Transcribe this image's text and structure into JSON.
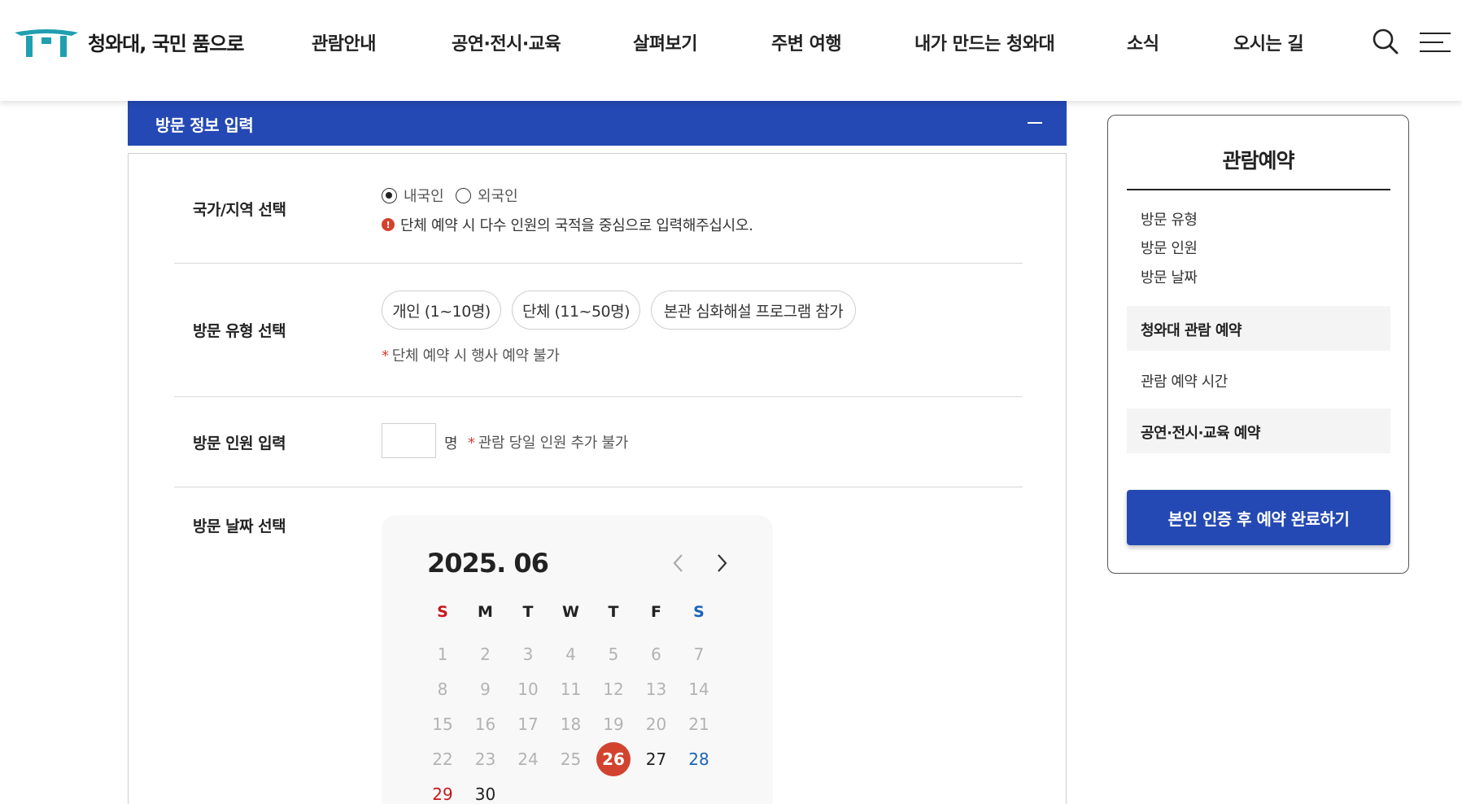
{
  "header": {
    "logo_text": "청와대, 국민 품으로",
    "nav": [
      "관람안내",
      "공연·전시·교육",
      "살펴보기",
      "주변 여행",
      "내가 만드는 청와대",
      "소식",
      "오시는 길"
    ],
    "icons": [
      "search-icon",
      "menu-icon"
    ]
  },
  "section": {
    "title": "방문 정보 입력",
    "collapse_icon": "minus-icon"
  },
  "form": {
    "country": {
      "label": "국가/지역 선택",
      "options": [
        "내국인",
        "외국인"
      ],
      "selected": "내국인",
      "info": "단체 예약 시 다수 인원의 국적을 중심으로 입력해주십시오.",
      "info_icon_glyph": "!"
    },
    "visit_type": {
      "label": "방문 유형 선택",
      "options": [
        "개인 (1~10명)",
        "단체 (11~50명)",
        "본관 심화해설 프로그램 참가"
      ],
      "note_star": "*",
      "note": "단체 예약 시 행사 예약 불가"
    },
    "people": {
      "label": "방문 인원 입력",
      "value": "",
      "unit": "명",
      "note_star": "*",
      "note": "관람 당일 인원 추가 불가"
    },
    "date": {
      "label": "방문 날짜 선택"
    }
  },
  "calendar": {
    "title": "2025. 06",
    "weekdays": [
      "S",
      "M",
      "T",
      "W",
      "T",
      "F",
      "S"
    ],
    "weekday_colors": [
      "#c8171e",
      "#222222",
      "#222222",
      "#222222",
      "#222222",
      "#222222",
      "#1a64b8"
    ],
    "days_in_month": 30,
    "first_weekday": 0,
    "today": 26,
    "first_available": 26,
    "colors": {
      "today": "#d2432f",
      "sunday": "#c8171e",
      "saturday": "#1a64b8",
      "disabled": "#b3b3b3"
    }
  },
  "side": {
    "title": "관람예약",
    "items": [
      "방문 유형",
      "방문 인원",
      "방문 날짜"
    ],
    "blocks": [
      {
        "label": "청와대 관람 예약",
        "style": "shaded"
      },
      {
        "label": "관람 예약 시간",
        "style": "plain"
      },
      {
        "label": "공연·전시·교육 예약",
        "style": "shaded"
      }
    ],
    "cta": "본인 인증 후 예약 완료하기"
  },
  "colors": {
    "primary": "#2449b4",
    "accent_red": "#d2432f",
    "logo_teal": "#1f9fb0"
  }
}
